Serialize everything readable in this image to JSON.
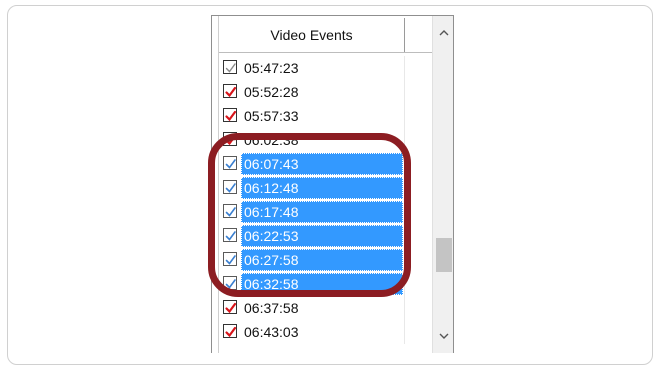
{
  "header": {
    "title": "Video Events"
  },
  "rows": [
    {
      "time": "05:47:23",
      "state": "grey",
      "selected": false
    },
    {
      "time": "05:52:28",
      "state": "red",
      "selected": false
    },
    {
      "time": "05:57:33",
      "state": "red",
      "selected": false
    },
    {
      "time": "06:02:38",
      "state": "red",
      "selected": false
    },
    {
      "time": "06:07:43",
      "state": "checked",
      "selected": true
    },
    {
      "time": "06:12:48",
      "state": "checked",
      "selected": true
    },
    {
      "time": "06:17:48",
      "state": "checked",
      "selected": true
    },
    {
      "time": "06:22:53",
      "state": "checked",
      "selected": true
    },
    {
      "time": "06:27:58",
      "state": "checked",
      "selected": true
    },
    {
      "time": "06:32:58",
      "state": "checked",
      "selected": true
    },
    {
      "time": "06:37:58",
      "state": "red",
      "selected": false
    },
    {
      "time": "06:43:03",
      "state": "red",
      "selected": false
    }
  ],
  "colors": {
    "selection": "#3399ff",
    "red_check": "#d7141a",
    "grey_check": "#8a8a8a",
    "selected_check": "#3a7fd0",
    "callout": "#8c1d22"
  },
  "icons": {
    "scroll_up": "chevron-up-icon",
    "scroll_down": "chevron-down-icon"
  }
}
